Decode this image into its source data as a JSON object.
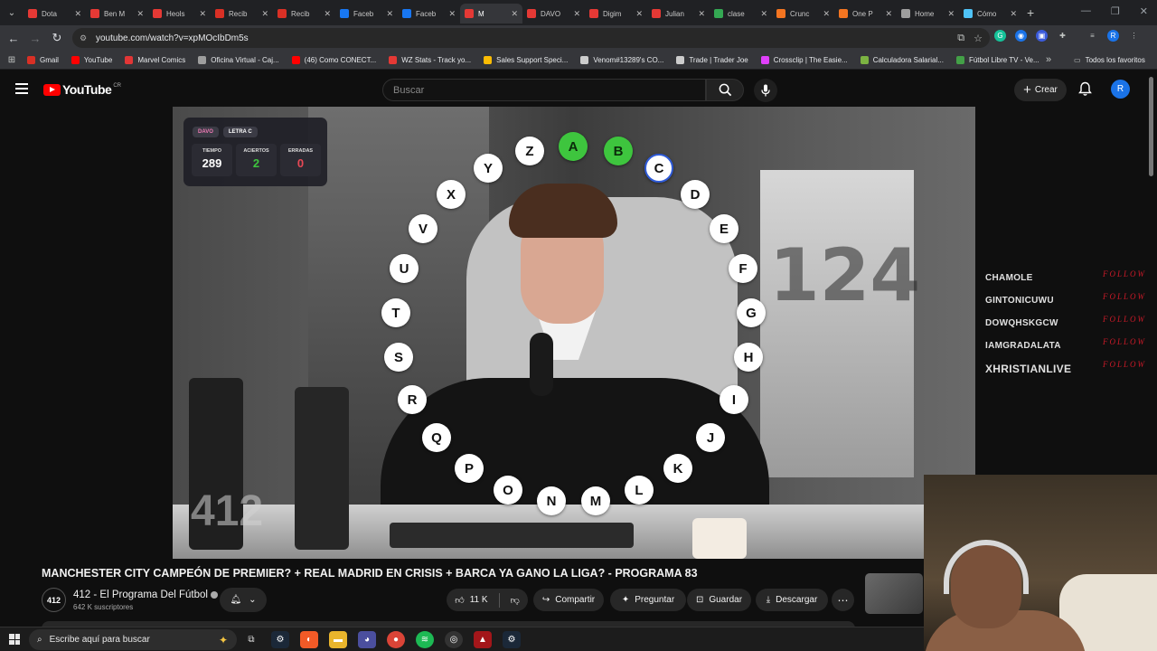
{
  "browser": {
    "tabs": [
      {
        "label": "Dota",
        "color": "#e53935"
      },
      {
        "label": "Ben M",
        "color": "#e53935"
      },
      {
        "label": "Heols",
        "color": "#e53935"
      },
      {
        "label": "Recib",
        "color": "#d93025"
      },
      {
        "label": "Recib",
        "color": "#d93025"
      },
      {
        "label": "Faceb",
        "color": "#1877f2"
      },
      {
        "label": "Faceb",
        "color": "#1877f2"
      },
      {
        "label": "M",
        "color": "#e53935",
        "active": true
      },
      {
        "label": "DAVO",
        "color": "#e53935"
      },
      {
        "label": "Digim",
        "color": "#e53935"
      },
      {
        "label": "Julian",
        "color": "#e53935"
      },
      {
        "label": "clase",
        "color": "#34a853"
      },
      {
        "label": "Crunc",
        "color": "#f47521"
      },
      {
        "label": "One P",
        "color": "#f47521"
      },
      {
        "label": "Home",
        "color": "#9e9e9e"
      },
      {
        "label": "Cómo",
        "color": "#4fc3f7"
      }
    ],
    "url": "youtube.com/watch?v=xpMOcIbDm5s",
    "bookmarks": [
      {
        "label": "Gmail",
        "color": "#d93025"
      },
      {
        "label": "YouTube",
        "color": "#ff0000"
      },
      {
        "label": "Marvel Comics",
        "color": "#e23636"
      },
      {
        "label": "Oficina Virtual - Caj...",
        "color": "#9e9e9e"
      },
      {
        "label": "(46) Como CONECT...",
        "color": "#ff0000"
      },
      {
        "label": "WZ Stats - Track yo...",
        "color": "#e53935"
      },
      {
        "label": "Sales Support Speci...",
        "color": "#fbbc04"
      },
      {
        "label": "Venom#13289's CO...",
        "color": "#cccccc"
      },
      {
        "label": "Trade | Trader Joe",
        "color": "#cccccc"
      },
      {
        "label": "Crossclip | The Easie...",
        "color": "#e040fb"
      },
      {
        "label": "Calculadora Salarial...",
        "color": "#7cb342"
      },
      {
        "label": "Fútbol Libre TV - Ve...",
        "color": "#43a047"
      }
    ],
    "bookmarks_more": "»",
    "all_bookmarks": "Todos los favoritos"
  },
  "youtube": {
    "logo_text": "YouTube",
    "country_code": "CR",
    "search_placeholder": "Buscar",
    "create_label": "Crear",
    "avatar_letter": "R"
  },
  "overlay": {
    "name_tag": "DAVO",
    "letter_tag": "LETRA C",
    "stats": [
      {
        "label": "TIEMPO",
        "value": "289",
        "color": "#ffffff"
      },
      {
        "label": "ACIERTOS",
        "value": "2",
        "color": "#3ec53e"
      },
      {
        "label": "ERRADAS",
        "value": "0",
        "color": "#e84855"
      }
    ],
    "rosco": [
      {
        "letter": "A",
        "state": "correct"
      },
      {
        "letter": "B",
        "state": "correct"
      },
      {
        "letter": "C",
        "state": "current"
      },
      {
        "letter": "D",
        "state": "pending"
      },
      {
        "letter": "E",
        "state": "pending"
      },
      {
        "letter": "F",
        "state": "pending"
      },
      {
        "letter": "G",
        "state": "pending"
      },
      {
        "letter": "H",
        "state": "pending"
      },
      {
        "letter": "I",
        "state": "pending"
      },
      {
        "letter": "J",
        "state": "pending"
      },
      {
        "letter": "K",
        "state": "pending"
      },
      {
        "letter": "L",
        "state": "pending"
      },
      {
        "letter": "M",
        "state": "pending"
      },
      {
        "letter": "N",
        "state": "pending"
      },
      {
        "letter": "O",
        "state": "pending"
      },
      {
        "letter": "P",
        "state": "pending"
      },
      {
        "letter": "Q",
        "state": "pending"
      },
      {
        "letter": "R",
        "state": "pending"
      },
      {
        "letter": "S",
        "state": "pending"
      },
      {
        "letter": "T",
        "state": "pending"
      },
      {
        "letter": "U",
        "state": "pending"
      },
      {
        "letter": "V",
        "state": "pending"
      },
      {
        "letter": "X",
        "state": "pending"
      },
      {
        "letter": "Y",
        "state": "pending"
      },
      {
        "letter": "Z",
        "state": "pending"
      }
    ],
    "follow_list": [
      {
        "name": "CHAMOLE",
        "tag": "FOLLOW"
      },
      {
        "name": "GINTONICUWU",
        "tag": "FOLLOW"
      },
      {
        "name": "DOWQHSKGCW",
        "tag": "FOLLOW"
      },
      {
        "name": "IAMGRADALATA",
        "tag": "FOLLOW"
      },
      {
        "name": "XHRISTIANLIVE",
        "tag": "FOLLOW"
      }
    ],
    "watermark": "412",
    "big_number": "124"
  },
  "video": {
    "title": "MANCHESTER CITY CAMPEÓN DE PREMIER? + REAL MADRID EN CRISIS + BARCA YA GANO LA LIGA? - PROGRAMA 83",
    "channel_name": "412 - El Programa Del Fútbol",
    "channel_avatar_text": "412",
    "subscribers": "642 K suscriptores",
    "likes": "11 K",
    "share_label": "Compartir",
    "ask_label": "Preguntar",
    "save_label": "Guardar",
    "download_label": "Descargar"
  },
  "taskbar": {
    "search_placeholder": "Escribe aquí para buscar"
  }
}
